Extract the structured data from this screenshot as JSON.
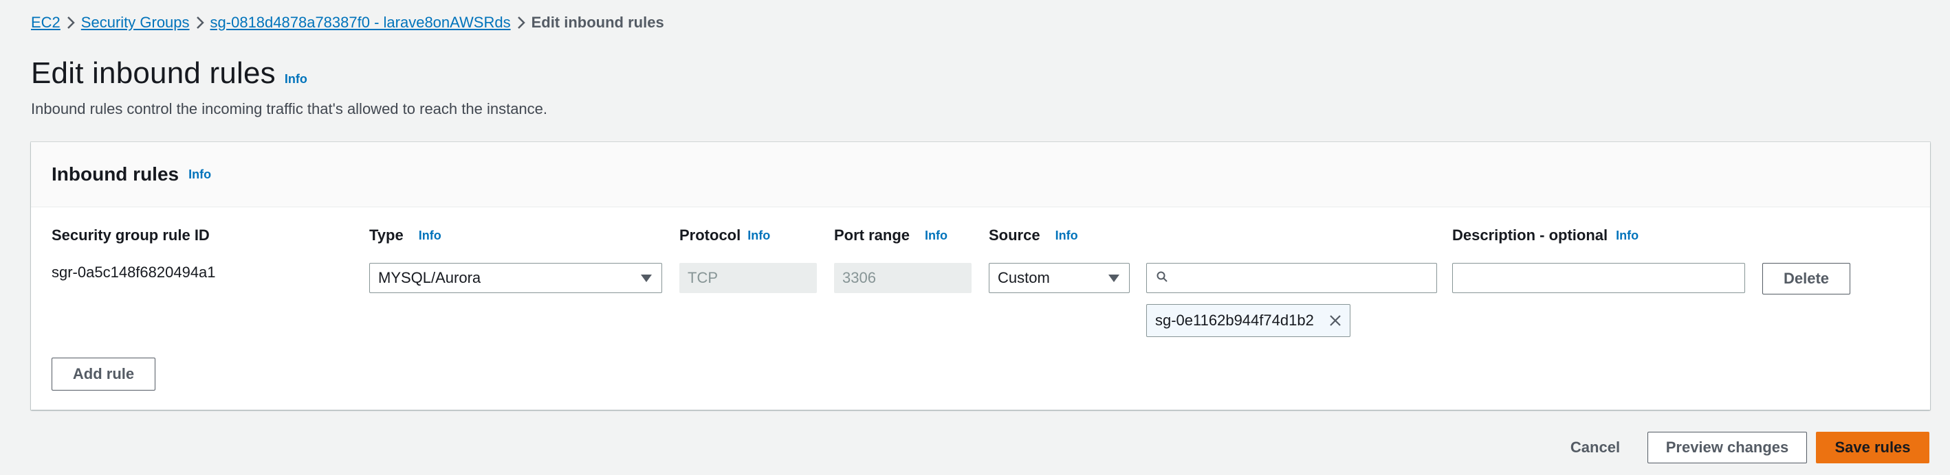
{
  "breadcrumb": {
    "items": [
      "EC2",
      "Security Groups",
      "sg-0818d4878a78387f0 - larave8onAWSRds"
    ],
    "current": "Edit inbound rules"
  },
  "header": {
    "title": "Edit inbound rules",
    "info": "Info",
    "description": "Inbound rules control the incoming traffic that's allowed to reach the instance."
  },
  "panel": {
    "title": "Inbound rules",
    "info": "Info",
    "columns": {
      "rule_id": "Security group rule ID",
      "type": "Type",
      "protocol": "Protocol",
      "port_range": "Port range",
      "source": "Source",
      "description": "Description - optional",
      "info": "Info"
    },
    "rule": {
      "id": "sgr-0a5c148f6820494a1",
      "type": "MYSQL/Aurora",
      "protocol": "TCP",
      "port_range": "3306",
      "source": "Custom",
      "source_search_value": "",
      "source_token": "sg-0e1162b944f74d1b2",
      "description": "",
      "delete_label": "Delete"
    },
    "add_rule_label": "Add rule"
  },
  "footer": {
    "cancel_label": "Cancel",
    "preview_label": "Preview changes",
    "save_label": "Save rules"
  },
  "colors": {
    "link": "#0073bb",
    "primary": "#ec7211",
    "background": "#f2f3f3"
  },
  "icons": [
    "chevron-right-icon",
    "caret-down-icon",
    "search-icon",
    "close-icon"
  ]
}
